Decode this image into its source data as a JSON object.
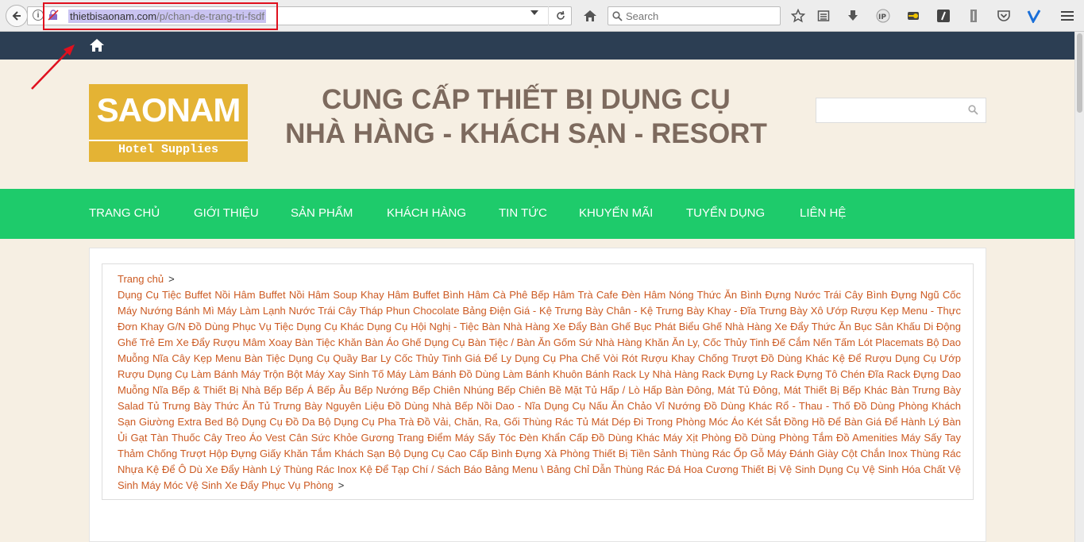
{
  "browser": {
    "url_host": "thietbisaonam.com",
    "url_path": "/p/chan-de-trang-tri-fsdf",
    "search_placeholder": "Search"
  },
  "header": {
    "logo_main": "SAONAM",
    "logo_sub": "Hotel Supplies",
    "headline_line1": "CUNG CẤP THIẾT BỊ DỤNG CỤ",
    "headline_line2": "NHÀ HÀNG - KHÁCH SẠN - RESORT"
  },
  "nav": {
    "items": [
      "TRANG CHỦ",
      "GIỚI THIỆU",
      "SẢN PHẨM",
      "KHÁCH HÀNG",
      "TIN TỨC",
      "KHUYẾN MÃI",
      "TUYỂN DỤNG",
      "LIÊN HỆ"
    ]
  },
  "breadcrumb": {
    "home": "Trang chủ",
    "separator": ">",
    "category_text": "Dụng Cụ Tiệc Buffet Nồi Hâm Buffet Nồi Hâm Soup Khay Hâm Buffet Bình Hâm Cà Phê Bếp Hâm Trà Cafe Đèn Hâm Nóng Thức Ăn Bình Đựng Nước Trái Cây Bình Đựng Ngũ Cốc Máy Nướng Bánh Mì Máy Làm Lạnh Nước Trái Cây Tháp Phun Chocolate Bảng Điện Giá - Kệ Trưng Bày Chân - Kệ Trưng Bày Khay - Đĩa Trưng Bày Xô Ướp Rượu Kẹp Menu - Thực Đơn Khay G/N Đồ Dùng Phục Vụ Tiệc Dụng Cụ Khác Dụng Cụ Hội Nghị - Tiệc Bàn Nhà Hàng Xe Đẩy Bàn Ghế Bục Phát Biểu Ghế Nhà Hàng Xe Đẩy Thức Ăn Bục Sân Khấu Di Động Ghế Trẻ Em Xe Đẩy Rượu Mâm Xoay Bàn Tiệc Khăn Bàn Áo Ghế Dụng Cụ Bàn Tiệc / Bàn Ăn Gốm Sứ Nhà Hàng Khăn Ăn Ly, Cốc Thủy Tinh Đế Cắm Nến Tấm Lót Placemats Bộ Dao Muỗng Nĩa Cây Kẹp Menu Bàn Tiệc Dụng Cụ Quầy Bar Ly Cốc Thủy Tinh Giá Để Ly Dụng Cụ Pha Chế Vòi Rót Rượu Khay Chống Trượt Đồ Dùng Khác Kệ Để Rượu Dụng Cụ Ướp Rượu Dụng Cụ Làm Bánh Máy Trộn Bột Máy Xay Sinh Tố Máy Làm Bánh Đồ Dùng Làm Bánh Khuôn Bánh Rack Ly Nhà Hàng Rack Đựng Ly Rack Đựng Tô Chén Đĩa Rack Đựng Dao Muỗng Nĩa Bếp & Thiết Bị Nhà Bếp Bếp Á Bếp Âu Bếp Nướng Bếp Chiên Nhúng Bếp Chiên Bề Mặt Tủ Hấp / Lò Hấp Bàn Đông, Mát Tủ Đông, Mát Thiết Bị Bếp Khác Bàn Trưng Bày Salad Tủ Trưng Bày Thức Ăn Tủ Trưng Bày Nguyên Liệu Đồ Dùng Nhà Bếp Nồi Dao - Nĩa Dụng Cụ Nấu Ăn Chảo Vỉ Nướng Đồ Dùng Khác Rổ - Thau - Thố Đồ Dùng Phòng Khách Sạn Giường Extra Bed Bộ Dụng Cụ Đồ Da Bộ Dụng Cụ Pha Trà Đồ Vải, Chăn, Ra, Gối Thùng Rác Tủ Mát Dép Đi Trong Phòng Móc Áo Két Sắt Đồng Hồ Để Bàn Giá Để Hành Lý Bàn Ủi Gạt Tàn Thuốc Cây Treo Áo Vest Cân Sức Khỏe Gương Trang Điểm Máy Sấy Tóc Đèn Khẩn Cấp Đồ Dùng Khác Máy Xịt Phòng Đồ Dùng Phòng Tắm Đồ Amenities Máy Sấy Tay Thảm Chống Trượt Hộp Đựng Giấy Khăn Tắm Khách Sạn Bộ Dụng Cụ Cao Cấp Bình Đựng Xà Phòng Thiết Bị Tiền Sảnh Thùng Rác Ốp Gỗ Máy Đánh Giày Cột Chắn Inox Thùng Rác Nhựa Kệ Để Ô Dù Xe Đẩy Hành Lý Thùng Rác Inox Kệ Để Tạp Chí / Sách Báo Bảng Menu \\ Bảng Chỉ Dẫn Thùng Rác Đá Hoa Cương Thiết Bị Vệ Sinh Dụng Cụ Vệ Sinh Hóa Chất Vệ Sinh Máy Móc Vệ Sinh Xe Đẩy Phục Vụ Phòng"
  },
  "colors": {
    "topbar": "#2c3e53",
    "nav": "#1ecb6b",
    "logo": "#e4b334",
    "headline": "#7d6a5e",
    "link": "#cc5a22",
    "page_bg": "#f6efe3",
    "annotation": "#e0101e"
  }
}
